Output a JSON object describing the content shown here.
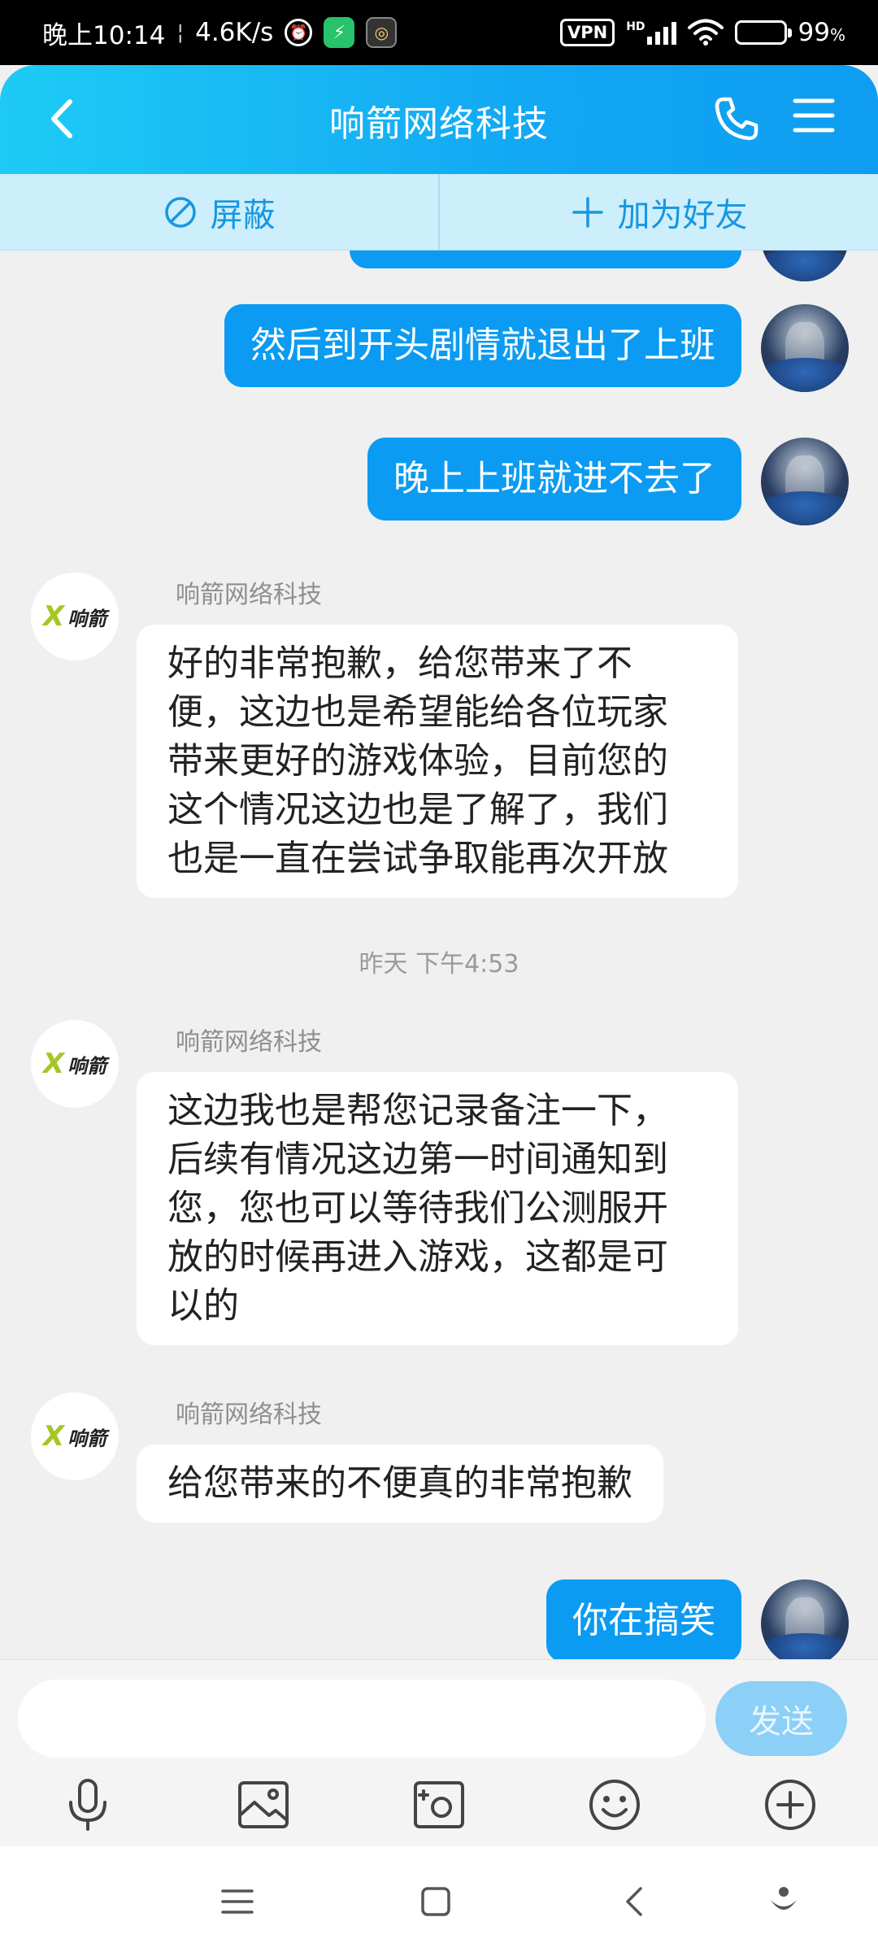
{
  "status_bar": {
    "time": "晚上10:14",
    "speed": "4.6K/s",
    "vpn": "VPN",
    "hd": "HD",
    "battery": "99",
    "battery_unit": "%",
    "battery_level": 0.99
  },
  "header": {
    "title": "响箭网络科技"
  },
  "actions": {
    "block_label": "屏蔽",
    "add_friend_label": "加为好友"
  },
  "bot_brand": {
    "mark": "X",
    "text": "响箭"
  },
  "messages": [
    {
      "side": "out",
      "text": "然后到开头剧情就退出了上班"
    },
    {
      "side": "out",
      "text": "晚上上班就进不去了"
    },
    {
      "side": "in",
      "sender": "响箭网络科技",
      "lines": [
        "好的非常抱歉，给您带来了不",
        "便，这边也是希望能给各位玩家",
        "带来更好的游戏体验，目前您的",
        "这个情况这边也是了解了，我们",
        "也是一直在尝试争取能再次开放"
      ]
    },
    {
      "type": "timestamp",
      "text": "昨天 下午4:53"
    },
    {
      "side": "in",
      "sender": "响箭网络科技",
      "lines": [
        "这边我也是帮您记录备注一下，",
        "后续有情况这边第一时间通知到",
        "您，您也可以等待我们公测服开",
        "放的时候再进入游戏，这都是可",
        "以的"
      ]
    },
    {
      "side": "in",
      "sender": "响箭网络科技",
      "text": "给您带来的不便真的非常抱歉"
    },
    {
      "side": "out",
      "text": "你在搞笑"
    }
  ],
  "input": {
    "value": "",
    "placeholder": "",
    "send_label": "发送"
  },
  "colors": {
    "accent": "#0b9bf2",
    "header_start": "#1ecbf5",
    "header_end": "#0e9df1",
    "action_bar": "#cdeefb",
    "send_disabled": "#8ccff7"
  }
}
